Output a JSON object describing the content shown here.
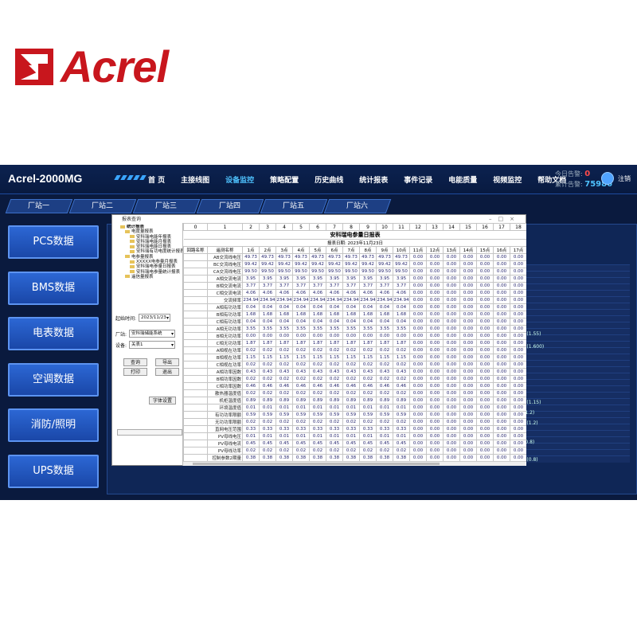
{
  "logo": {
    "text": "Acrel",
    "color": "#c8161d"
  },
  "app": {
    "title": "Acrel-2000MG",
    "logout": "注销",
    "alarm_today_label": "今日告警:",
    "alarm_today": "0",
    "alarm_total_label": "累计告警:",
    "alarm_total": "75986"
  },
  "nav": [
    "首  页",
    "主接线图",
    "设备监控",
    "策略配置",
    "历史曲线",
    "统计报表",
    "事件记录",
    "电能质量",
    "视频监控",
    "帮助文档"
  ],
  "nav_active": "设备监控",
  "stations": [
    "厂站一",
    "厂站二",
    "厂站三",
    "厂站四",
    "厂站五",
    "厂站六"
  ],
  "menu": [
    "PCS数据",
    "BMS数据",
    "电表数据",
    "空调数据",
    "消防/照明",
    "UPS数据"
  ],
  "bg_labels": [
    "U(1.55)",
    "U(1.600)",
    "U(1.15)",
    "(1.2)",
    "U(1.2)",
    "(0.8)",
    "U(0.8)"
  ],
  "dialog": {
    "title": "报表查询",
    "tree": [
      {
        "level": 0,
        "label": "统计报表"
      },
      {
        "level": 1,
        "label": "电度量报表"
      },
      {
        "level": 2,
        "label": "安科瑞电能年报表"
      },
      {
        "level": 2,
        "label": "安科瑞电能月报表"
      },
      {
        "level": 2,
        "label": "安科瑞电能日报表"
      },
      {
        "level": 2,
        "label": "安科瑞有功电度统计报表"
      },
      {
        "level": 1,
        "label": "电参量报表"
      },
      {
        "level": 2,
        "label": "XXXXX电参量月报表"
      },
      {
        "level": 2,
        "label": "安科瑞电参量日报表"
      },
      {
        "level": 2,
        "label": "安科瑞电参量统计报表"
      },
      {
        "level": 1,
        "label": "遥信量报表"
      }
    ],
    "start_label": "起始时间:",
    "start_value": "2023/11/23",
    "station_label": "厂站:",
    "station_value": "安科瑞储能系统",
    "device_label": "设备:",
    "device_value": "关表1",
    "buttons": {
      "query": "查询",
      "export": "导出",
      "print": "打印",
      "exit": "退出",
      "font": "字体设置"
    }
  },
  "report": {
    "col_headers": [
      "0",
      "1",
      "2",
      "3",
      "4",
      "5",
      "6",
      "7",
      "8",
      "9",
      "10",
      "11",
      "12",
      "13",
      "14",
      "15",
      "16",
      "17",
      "18"
    ],
    "title": "安科瑞电参量日报表",
    "date": "报表日期:  2023年11月23日",
    "hours": [
      "1点",
      "2点",
      "3点",
      "4点",
      "5点",
      "6点",
      "7点",
      "8点",
      "9点",
      "10点",
      "11点",
      "12点",
      "13点",
      "14点",
      "15点",
      "16点",
      "17点"
    ],
    "row_header_a": "回路名称",
    "row_header_b": "遥测名称",
    "rows": [
      {
        "name": "AB交流线电压",
        "vals": [
          "49.73",
          "49.73",
          "49.73",
          "49.73",
          "49.73",
          "49.73",
          "49.73",
          "49.73",
          "49.73",
          "49.73",
          "0.00",
          "0.00",
          "0.00",
          "0.00",
          "0.00",
          "0.00",
          "0.00"
        ]
      },
      {
        "name": "BC交流线电压",
        "vals": [
          "99.42",
          "99.42",
          "99.42",
          "99.42",
          "99.42",
          "99.42",
          "99.42",
          "99.42",
          "99.42",
          "99.42",
          "0.00",
          "0.00",
          "0.00",
          "0.00",
          "0.00",
          "0.00",
          "0.00"
        ]
      },
      {
        "name": "CA交流线电压",
        "vals": [
          "99.50",
          "99.50",
          "99.50",
          "99.50",
          "99.50",
          "99.50",
          "99.50",
          "99.50",
          "99.50",
          "99.50",
          "0.00",
          "0.00",
          "0.00",
          "0.00",
          "0.00",
          "0.00",
          "0.00"
        ]
      },
      {
        "name": "A相交流电流",
        "vals": [
          "3.95",
          "3.95",
          "3.95",
          "3.95",
          "3.95",
          "3.95",
          "3.95",
          "3.95",
          "3.95",
          "3.95",
          "0.00",
          "0.00",
          "0.00",
          "0.00",
          "0.00",
          "0.00",
          "0.00"
        ]
      },
      {
        "name": "B相交流电流",
        "vals": [
          "3.77",
          "3.77",
          "3.77",
          "3.77",
          "3.77",
          "3.77",
          "3.77",
          "3.77",
          "3.77",
          "3.77",
          "0.00",
          "0.00",
          "0.00",
          "0.00",
          "0.00",
          "0.00",
          "0.00"
        ]
      },
      {
        "name": "C相交流电流",
        "vals": [
          "4.06",
          "4.06",
          "4.06",
          "4.06",
          "4.06",
          "4.06",
          "4.06",
          "4.06",
          "4.06",
          "4.06",
          "0.00",
          "0.00",
          "0.00",
          "0.00",
          "0.00",
          "0.00",
          "0.00"
        ]
      },
      {
        "name": "交流频率",
        "vals": [
          "234.94",
          "234.94",
          "234.94",
          "234.94",
          "234.94",
          "234.94",
          "234.94",
          "234.94",
          "234.94",
          "234.94",
          "0.00",
          "0.00",
          "0.00",
          "0.00",
          "0.00",
          "0.00",
          "0.00"
        ]
      },
      {
        "name": "A相有功功率",
        "vals": [
          "0.04",
          "0.04",
          "0.04",
          "0.04",
          "0.04",
          "0.04",
          "0.04",
          "0.04",
          "0.04",
          "0.04",
          "0.00",
          "0.00",
          "0.00",
          "0.00",
          "0.00",
          "0.00",
          "0.00"
        ]
      },
      {
        "name": "B相有功功率",
        "vals": [
          "1.68",
          "1.68",
          "1.68",
          "1.68",
          "1.68",
          "1.68",
          "1.68",
          "1.68",
          "1.68",
          "1.68",
          "0.00",
          "0.00",
          "0.00",
          "0.00",
          "0.00",
          "0.00",
          "0.00"
        ]
      },
      {
        "name": "C相有功功率",
        "vals": [
          "0.04",
          "0.04",
          "0.04",
          "0.04",
          "0.04",
          "0.04",
          "0.04",
          "0.04",
          "0.04",
          "0.04",
          "0.00",
          "0.00",
          "0.00",
          "0.00",
          "0.00",
          "0.00",
          "0.00"
        ]
      },
      {
        "name": "A相无功功率",
        "vals": [
          "3.55",
          "3.55",
          "3.55",
          "3.55",
          "3.55",
          "3.55",
          "3.55",
          "3.55",
          "3.55",
          "3.55",
          "0.00",
          "0.00",
          "0.00",
          "0.00",
          "0.00",
          "0.00",
          "0.00"
        ]
      },
      {
        "name": "B相无功功率",
        "vals": [
          "0.00",
          "0.00",
          "0.00",
          "0.00",
          "0.00",
          "0.00",
          "0.00",
          "0.00",
          "0.00",
          "0.00",
          "0.00",
          "0.00",
          "0.00",
          "0.00",
          "0.00",
          "0.00",
          "0.00"
        ]
      },
      {
        "name": "C相无功功率",
        "vals": [
          "1.87",
          "1.87",
          "1.87",
          "1.87",
          "1.87",
          "1.87",
          "1.87",
          "1.87",
          "1.87",
          "1.87",
          "0.00",
          "0.00",
          "0.00",
          "0.00",
          "0.00",
          "0.00",
          "0.00"
        ]
      },
      {
        "name": "A相视在功率",
        "vals": [
          "0.02",
          "0.02",
          "0.02",
          "0.02",
          "0.02",
          "0.02",
          "0.02",
          "0.02",
          "0.02",
          "0.02",
          "0.00",
          "0.00",
          "0.00",
          "0.00",
          "0.00",
          "0.00",
          "0.00"
        ]
      },
      {
        "name": "B相视在功率",
        "vals": [
          "1.15",
          "1.15",
          "1.15",
          "1.15",
          "1.15",
          "1.15",
          "1.15",
          "1.15",
          "1.15",
          "1.15",
          "0.00",
          "0.00",
          "0.00",
          "0.00",
          "0.00",
          "0.00",
          "0.00"
        ]
      },
      {
        "name": "C相视在功率",
        "vals": [
          "0.02",
          "0.02",
          "0.02",
          "0.02",
          "0.02",
          "0.02",
          "0.02",
          "0.02",
          "0.02",
          "0.02",
          "0.00",
          "0.00",
          "0.00",
          "0.00",
          "0.00",
          "0.00",
          "0.00"
        ]
      },
      {
        "name": "A相功率因数",
        "vals": [
          "0.43",
          "0.43",
          "0.43",
          "0.43",
          "0.43",
          "0.43",
          "0.43",
          "0.43",
          "0.43",
          "0.43",
          "0.00",
          "0.00",
          "0.00",
          "0.00",
          "0.00",
          "0.00",
          "0.00"
        ]
      },
      {
        "name": "B相功率因数",
        "vals": [
          "0.02",
          "0.02",
          "0.02",
          "0.02",
          "0.02",
          "0.02",
          "0.02",
          "0.02",
          "0.02",
          "0.02",
          "0.00",
          "0.00",
          "0.00",
          "0.00",
          "0.00",
          "0.00",
          "0.00"
        ]
      },
      {
        "name": "C相功率因数",
        "vals": [
          "0.46",
          "0.46",
          "0.46",
          "0.46",
          "0.46",
          "0.46",
          "0.46",
          "0.46",
          "0.46",
          "0.46",
          "0.00",
          "0.00",
          "0.00",
          "0.00",
          "0.00",
          "0.00",
          "0.00"
        ]
      },
      {
        "name": "散热器温度值",
        "vals": [
          "0.02",
          "0.02",
          "0.02",
          "0.02",
          "0.02",
          "0.02",
          "0.02",
          "0.02",
          "0.02",
          "0.02",
          "0.00",
          "0.00",
          "0.00",
          "0.00",
          "0.00",
          "0.00",
          "0.00"
        ]
      },
      {
        "name": "机柜温度值",
        "vals": [
          "0.89",
          "0.89",
          "0.89",
          "0.89",
          "0.89",
          "0.89",
          "0.89",
          "0.89",
          "0.89",
          "0.89",
          "0.00",
          "0.00",
          "0.00",
          "0.00",
          "0.00",
          "0.00",
          "0.00"
        ]
      },
      {
        "name": "环境温度值",
        "vals": [
          "0.01",
          "0.01",
          "0.01",
          "0.01",
          "0.01",
          "0.01",
          "0.01",
          "0.01",
          "0.01",
          "0.01",
          "0.00",
          "0.00",
          "0.00",
          "0.00",
          "0.00",
          "0.00",
          "0.00"
        ]
      },
      {
        "name": "有功功率限额",
        "vals": [
          "0.59",
          "0.59",
          "0.59",
          "0.59",
          "0.59",
          "0.59",
          "0.59",
          "0.59",
          "0.59",
          "0.59",
          "0.00",
          "0.00",
          "0.00",
          "0.00",
          "0.00",
          "0.00",
          "0.00"
        ]
      },
      {
        "name": "无功功率限额",
        "vals": [
          "0.02",
          "0.02",
          "0.02",
          "0.02",
          "0.02",
          "0.02",
          "0.02",
          "0.02",
          "0.02",
          "0.02",
          "0.00",
          "0.00",
          "0.00",
          "0.00",
          "0.00",
          "0.00",
          "0.00"
        ]
      },
      {
        "name": "直网电压范围",
        "vals": [
          "0.33",
          "0.33",
          "0.33",
          "0.33",
          "0.33",
          "0.33",
          "0.33",
          "0.33",
          "0.33",
          "0.33",
          "0.00",
          "0.00",
          "0.00",
          "0.00",
          "0.00",
          "0.00",
          "0.00"
        ]
      },
      {
        "name": "PV母线电压",
        "vals": [
          "0.01",
          "0.01",
          "0.01",
          "0.01",
          "0.01",
          "0.01",
          "0.01",
          "0.01",
          "0.01",
          "0.01",
          "0.00",
          "0.00",
          "0.00",
          "0.00",
          "0.00",
          "0.00",
          "0.00"
        ]
      },
      {
        "name": "PV母线电流",
        "vals": [
          "0.45",
          "0.45",
          "0.45",
          "0.45",
          "0.45",
          "0.45",
          "0.45",
          "0.45",
          "0.45",
          "0.45",
          "0.00",
          "0.00",
          "0.00",
          "0.00",
          "0.00",
          "0.00",
          "0.00"
        ]
      },
      {
        "name": "PV母线功率",
        "vals": [
          "0.02",
          "0.02",
          "0.02",
          "0.02",
          "0.02",
          "0.02",
          "0.02",
          "0.02",
          "0.02",
          "0.02",
          "0.00",
          "0.00",
          "0.00",
          "0.00",
          "0.00",
          "0.00",
          "0.00"
        ]
      },
      {
        "name": "控制参数2期量",
        "vals": [
          "0.38",
          "0.38",
          "0.38",
          "0.38",
          "0.38",
          "0.38",
          "0.38",
          "0.38",
          "0.38",
          "0.38",
          "0.00",
          "0.00",
          "0.00",
          "0.00",
          "0.00",
          "0.00",
          "0.00"
        ]
      },
      {
        "name": "控制参数1期量",
        "vals": [
          "0.02",
          "0.02",
          "0.02",
          "0.02",
          "0.02",
          "0.02",
          "0.02",
          "0.02",
          "0.02",
          "0.02",
          "0.00",
          "0.00",
          "0.00",
          "0.00",
          "0.00",
          "0.00",
          "0.00"
        ]
      }
    ]
  }
}
